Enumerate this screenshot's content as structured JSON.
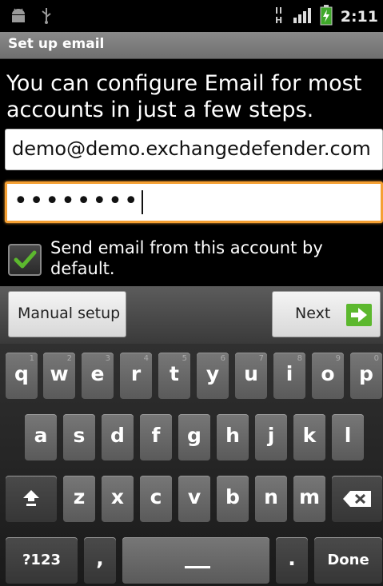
{
  "status_bar": {
    "time": "2:11",
    "left_icons": [
      "android-icon",
      "usb-icon"
    ],
    "right_icons": [
      "hspa-icon",
      "signal-icon",
      "battery-charging-icon"
    ]
  },
  "title_bar": {
    "title": "Set up email"
  },
  "intro_text": "You can configure Email for most accounts in just a few steps.",
  "email_field": {
    "value": "demo@demo.exchangedefender.com"
  },
  "password_field": {
    "value": "••••••••"
  },
  "default_account": {
    "checked": true,
    "label": "Send email from this account by default."
  },
  "buttons": {
    "manual_setup": "Manual setup",
    "next": "Next"
  },
  "keyboard": {
    "row1": [
      {
        "ch": "q",
        "hint": "1"
      },
      {
        "ch": "w",
        "hint": "2"
      },
      {
        "ch": "e",
        "hint": "3"
      },
      {
        "ch": "r",
        "hint": "4"
      },
      {
        "ch": "t",
        "hint": "5"
      },
      {
        "ch": "y",
        "hint": "6"
      },
      {
        "ch": "u",
        "hint": "7"
      },
      {
        "ch": "i",
        "hint": "8"
      },
      {
        "ch": "o",
        "hint": "9"
      },
      {
        "ch": "p",
        "hint": "0"
      }
    ],
    "row2": [
      "a",
      "s",
      "d",
      "f",
      "g",
      "h",
      "j",
      "k",
      "l"
    ],
    "row3": [
      "z",
      "x",
      "c",
      "v",
      "b",
      "n",
      "m"
    ],
    "symbols_key": "?123",
    "comma_key": ",",
    "period_key": ".",
    "done_key": "Done"
  },
  "colors": {
    "focus_border": "#f5a033",
    "check_green": "#5cb82e",
    "title_bar": "#7a7a7a"
  }
}
